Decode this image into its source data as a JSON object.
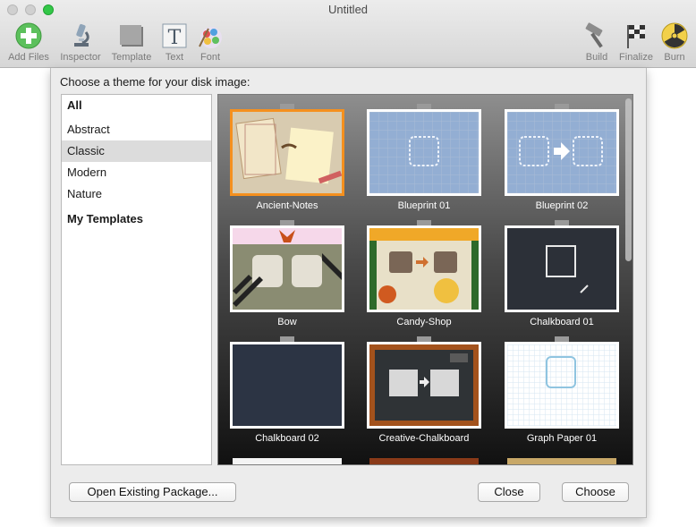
{
  "window": {
    "title": "Untitled"
  },
  "toolbar": {
    "left": [
      {
        "label": "Add Files",
        "icon": "add-files-icon"
      },
      {
        "label": "Inspector",
        "icon": "microscope-icon"
      },
      {
        "label": "Template",
        "icon": "template-icon"
      },
      {
        "label": "Text",
        "icon": "text-icon"
      },
      {
        "label": "Font",
        "icon": "font-color-icon"
      }
    ],
    "right": [
      {
        "label": "Build",
        "icon": "hammer-icon"
      },
      {
        "label": "Finalize",
        "icon": "checkered-flag-icon"
      },
      {
        "label": "Burn",
        "icon": "burn-radiation-icon"
      }
    ]
  },
  "sheet": {
    "prompt": "Choose a theme for your disk image:",
    "categories": [
      {
        "label": "All",
        "bold": true,
        "selected": false
      },
      {
        "label": "Abstract",
        "bold": false,
        "selected": false
      },
      {
        "label": "Classic",
        "bold": false,
        "selected": true
      },
      {
        "label": "Modern",
        "bold": false,
        "selected": false
      },
      {
        "label": "Nature",
        "bold": false,
        "selected": false
      },
      {
        "label": "My Templates",
        "bold": true,
        "selected": false
      }
    ],
    "themes": [
      {
        "name": "Ancient-Notes",
        "selected": true
      },
      {
        "name": "Blueprint 01",
        "selected": false
      },
      {
        "name": "Blueprint 02",
        "selected": false
      },
      {
        "name": "Bow",
        "selected": false
      },
      {
        "name": "Candy-Shop",
        "selected": false
      },
      {
        "name": "Chalkboard 01",
        "selected": false
      },
      {
        "name": "Chalkboard 02",
        "selected": false
      },
      {
        "name": "Creative-Chalkboard",
        "selected": false
      },
      {
        "name": "Graph Paper 01",
        "selected": false
      }
    ],
    "buttons": {
      "open_existing": "Open Existing Package...",
      "close": "Close",
      "choose": "Choose"
    }
  },
  "colors": {
    "selection_accent": "#f5901e",
    "zoom_button": "#33c748"
  }
}
